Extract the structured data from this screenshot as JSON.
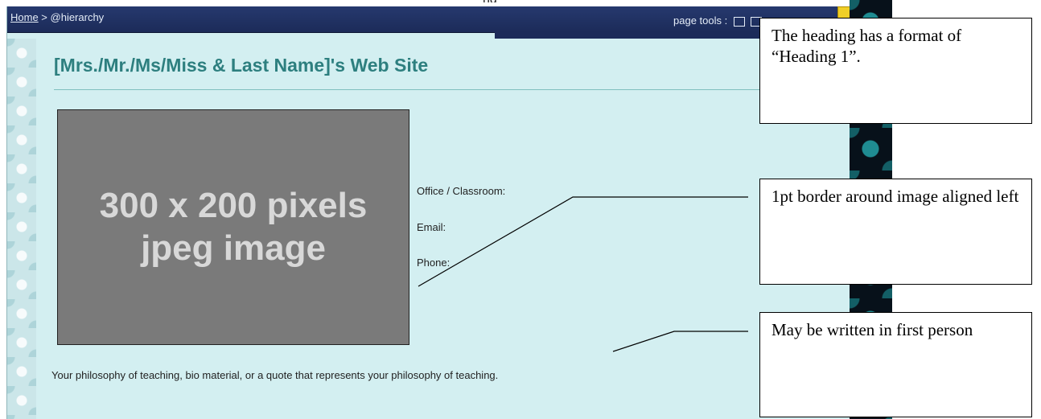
{
  "top_cut_text": "ng",
  "breadcrumb": {
    "home": "Home",
    "separator": " > ",
    "current": "@hierarchy"
  },
  "page_tools": {
    "label": "page tools :"
  },
  "site_title": "[Mrs./Mr./Ms/Miss & Last Name]'s Web Site",
  "image_placeholder": {
    "line1": "300 x 200 pixels",
    "line2": "jpeg image"
  },
  "contact": {
    "office": "Office / Classroom:",
    "email": "Email:",
    "phone": "Phone:"
  },
  "philosophy": "Your philosophy of teaching, bio material, or a quote that represents your philosophy of teaching.",
  "callouts": {
    "heading": "The heading has a format of “Heading 1”.",
    "border": "1pt border around image aligned left",
    "first_person": "May be written in first person"
  },
  "colors": {
    "topbar": "#1c2b59",
    "page_bg": "#d3eff1",
    "title": "#2d7f7f",
    "placeholder": "#7a7a7a"
  }
}
